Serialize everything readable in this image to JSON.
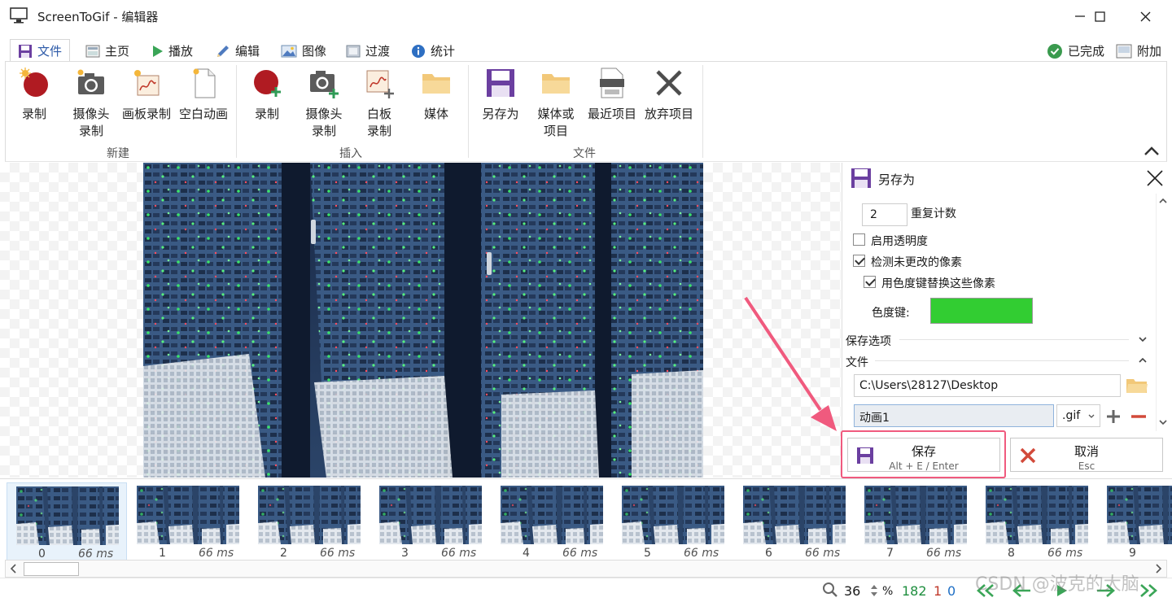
{
  "window": {
    "title": "ScreenToGif - 编辑器"
  },
  "tabs": [
    {
      "label": "文件",
      "icon": "floppy-icon",
      "active": true
    },
    {
      "label": "主页",
      "icon": "home-image-icon"
    },
    {
      "label": "播放",
      "icon": "play-icon"
    },
    {
      "label": "编辑",
      "icon": "pencil-icon"
    },
    {
      "label": "图像",
      "icon": "image-icon"
    },
    {
      "label": "过渡",
      "icon": "transition-icon"
    },
    {
      "label": "统计",
      "icon": "info-icon"
    }
  ],
  "header_right": {
    "done_label": "已完成",
    "attach_label": "附加"
  },
  "ribbon": {
    "groups": [
      {
        "label": "新建",
        "buttons": [
          {
            "label": "录制",
            "icon": "record-icon"
          },
          {
            "label": "摄像头\n录制",
            "icon": "webcam-icon"
          },
          {
            "label": "画板录制",
            "icon": "board-record-icon"
          },
          {
            "label": "空白动画",
            "icon": "blank-animation-icon"
          }
        ]
      },
      {
        "label": "插入",
        "buttons": [
          {
            "label": "录制",
            "icon": "record-add-icon"
          },
          {
            "label": "摄像头\n录制",
            "icon": "webcam-add-icon"
          },
          {
            "label": "白板\n录制",
            "icon": "board-add-icon"
          },
          {
            "label": "媒体",
            "icon": "folder-icon"
          }
        ]
      },
      {
        "label": "文件",
        "buttons": [
          {
            "label": "另存为",
            "icon": "save-as-icon"
          },
          {
            "label": "媒体或\n项目",
            "icon": "open-folder-icon"
          },
          {
            "label": "最近项目",
            "icon": "recent-projects-icon"
          },
          {
            "label": "放弃项目",
            "icon": "discard-icon"
          }
        ]
      }
    ]
  },
  "save_panel": {
    "title": "另存为",
    "repeat_count_value": "2",
    "repeat_count_label": "重复计数",
    "enable_transparency": "启用透明度",
    "detect_unchanged": "检测未更改的像素",
    "chroma_replace": "用色度键替换这些像素",
    "chroma_key_label": "色度键:",
    "chroma_key_color": "#32CD32",
    "save_options_label": "保存选项",
    "file_section_label": "文件",
    "path_value": "C:\\Users\\28127\\Desktop",
    "filename_value": "动画1",
    "extension_value": ".gif",
    "save_button": {
      "label": "保存",
      "shortcut": "Alt + E / Enter"
    },
    "cancel_button": {
      "label": "取消",
      "shortcut": "Esc"
    }
  },
  "frames": [
    {
      "index": "0",
      "duration": "66 ms"
    },
    {
      "index": "1",
      "duration": "66 ms"
    },
    {
      "index": "2",
      "duration": "66 ms"
    },
    {
      "index": "3",
      "duration": "66 ms"
    },
    {
      "index": "4",
      "duration": "66 ms"
    },
    {
      "index": "5",
      "duration": "66 ms"
    },
    {
      "index": "6",
      "duration": "66 ms"
    },
    {
      "index": "7",
      "duration": "66 ms"
    },
    {
      "index": "8",
      "duration": "66 ms"
    },
    {
      "index": "9",
      "duration": ""
    }
  ],
  "status": {
    "zoom": "36",
    "zoom_unit": "%",
    "frame_count": "182",
    "selected_count": "1",
    "current_index": "0"
  },
  "watermark": "CSDN @波克的大脑",
  "colors": {
    "accent": "#6b3fa0",
    "highlight": "#f05a7e",
    "green": "#1e8e3e",
    "red": "#c0392b",
    "blue": "#1f6fc5"
  }
}
